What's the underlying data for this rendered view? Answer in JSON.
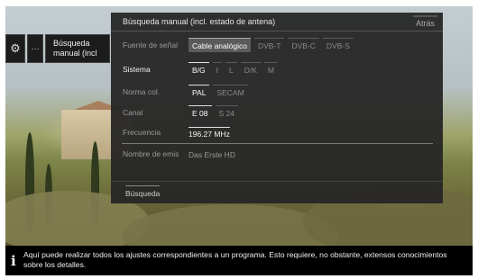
{
  "sidebar": {
    "gear_icon": "⚙",
    "dots": "···",
    "current_label": "Búsqueda manual (incl"
  },
  "dialog": {
    "title": "Búsqueda manual (incl. estado de antena)",
    "back_label": "Atrás",
    "rows": {
      "signal_source": {
        "label": "Fuente de señal",
        "options": [
          "Cable analógico",
          "DVB-T",
          "DVB-C",
          "DVB-S"
        ],
        "selected": "Cable analógico"
      },
      "system": {
        "label": "Sistema",
        "options": [
          "B/G",
          "I",
          "L",
          "D/K",
          "M"
        ],
        "selected": "B/G"
      },
      "color_norm": {
        "label": "Norma col.",
        "options": [
          "PAL",
          "SECAM"
        ],
        "selected": "PAL"
      },
      "channel": {
        "label": "Canal",
        "options": [
          "E 08",
          "S 24"
        ],
        "selected": "E 08"
      },
      "frequency": {
        "label": "Frecuencia",
        "value": "196.27 MHz"
      },
      "station_name": {
        "label": "Nombre de emis",
        "value": "Das Erste HD"
      }
    },
    "search_label": "Búsqueda"
  },
  "info_bar": {
    "icon": "i",
    "text": "Aquí puede realizar todos los ajustes correspondientes a un programa. Esto requiere, no obstante, extensos conocimientos sobre los detalles."
  }
}
